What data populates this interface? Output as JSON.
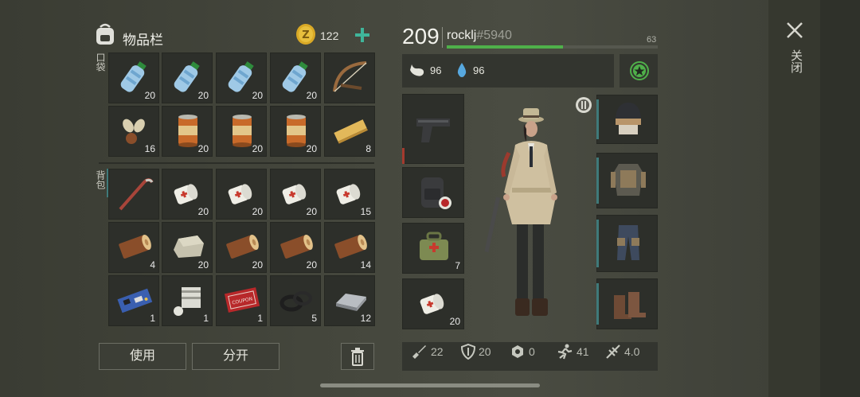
{
  "inventory": {
    "title": "物品栏",
    "coins": "122",
    "pocket_label": "口袋",
    "backpack_label": "背包",
    "pocket_items": [
      {
        "icon": "water-bottle-icon",
        "count": "20"
      },
      {
        "icon": "water-bottle-icon",
        "count": "20"
      },
      {
        "icon": "water-bottle-icon",
        "count": "20"
      },
      {
        "icon": "water-bottle-icon",
        "count": "20"
      },
      {
        "icon": "crossbow-icon",
        "count": ""
      },
      {
        "icon": "seeds-icon",
        "count": "16"
      },
      {
        "icon": "canned-food-icon",
        "count": "20"
      },
      {
        "icon": "canned-food-icon",
        "count": "20"
      },
      {
        "icon": "canned-food-icon",
        "count": "20"
      },
      {
        "icon": "plank-icon",
        "count": "8"
      }
    ],
    "backpack_items": [
      {
        "icon": "crowbar-icon",
        "count": ""
      },
      {
        "icon": "bandage-icon",
        "count": "20"
      },
      {
        "icon": "bandage-icon",
        "count": "20"
      },
      {
        "icon": "bandage-icon",
        "count": "20"
      },
      {
        "icon": "bandage-icon",
        "count": "15"
      },
      {
        "icon": "log-icon",
        "count": "4"
      },
      {
        "icon": "stone-icon",
        "count": "20"
      },
      {
        "icon": "log-icon",
        "count": "20"
      },
      {
        "icon": "log-icon",
        "count": "20"
      },
      {
        "icon": "log-icon",
        "count": "14"
      },
      {
        "icon": "circuit-board-icon",
        "count": "1"
      },
      {
        "icon": "engine-part-icon",
        "count": "1"
      },
      {
        "icon": "coupon-icon",
        "count": "1"
      },
      {
        "icon": "rubber-rings-icon",
        "count": "5"
      },
      {
        "icon": "iron-bar-icon",
        "count": "12"
      }
    ],
    "coupon_text": "COMBAT GEAR COUPON",
    "use_label": "使用",
    "split_label": "分开"
  },
  "player": {
    "level": "209",
    "name": "rocklj",
    "id": "#5940",
    "xp_value": "63",
    "xp_fraction": 0.55,
    "food": "96",
    "water": "96"
  },
  "equipment": {
    "left_slots": [
      {
        "icon": "pistol-icon",
        "count": ""
      },
      {
        "icon": "backpack-icon",
        "count": ""
      },
      {
        "icon": "medkit-bag-icon",
        "count": "7"
      },
      {
        "icon": "bandage-icon",
        "count": "20"
      }
    ],
    "right_slots": [
      {
        "icon": "helmet-icon"
      },
      {
        "icon": "armor-vest-icon"
      },
      {
        "icon": "armored-pants-icon"
      },
      {
        "icon": "boots-icon"
      }
    ]
  },
  "stats": {
    "attack": "22",
    "defense": "20",
    "radiation": "0",
    "speed": "41",
    "stealth": "4.0"
  },
  "close_label": "关闭",
  "colors": {
    "accent_green": "#4fb04a",
    "teal": "#3f7a7a",
    "coin": "#d9a926"
  }
}
